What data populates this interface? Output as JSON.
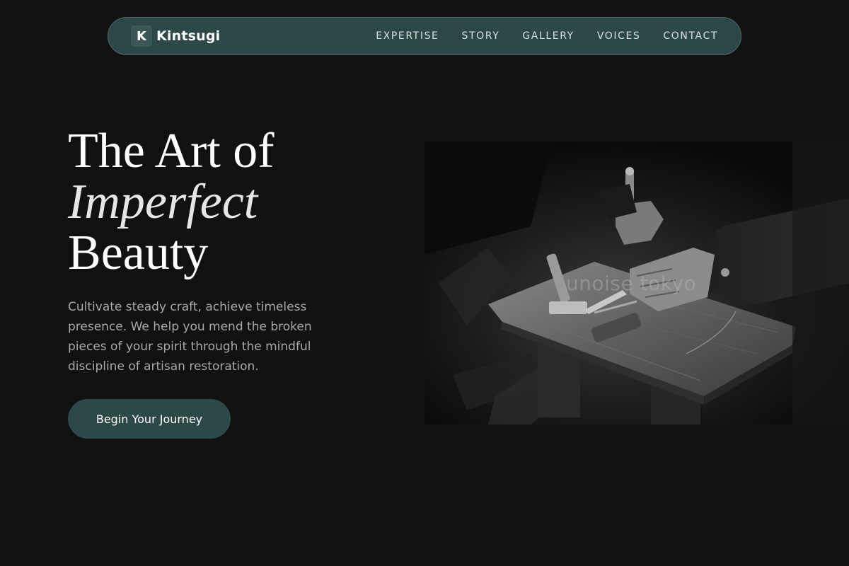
{
  "brand": {
    "mark": "K",
    "name": "Kintsugi"
  },
  "nav": {
    "links": [
      "EXPERTISE",
      "STORY",
      "GALLERY",
      "VOICES",
      "CONTACT"
    ]
  },
  "hero": {
    "title_line1": "The Art of",
    "title_line2": "Imperfect",
    "title_line3": "Beauty",
    "description": "Cultivate steady craft, achieve timeless presence. We help you mend the broken pieces of your spirit through the mindful discipline of artisan restoration.",
    "cta_label": "Begin Your Journey"
  },
  "image": {
    "watermark": "unoise tokyo"
  },
  "colors": {
    "background": "#111111",
    "nav_bg": "#2c4747",
    "accent": "#2c4848",
    "body_text": "#a9a9a9"
  }
}
